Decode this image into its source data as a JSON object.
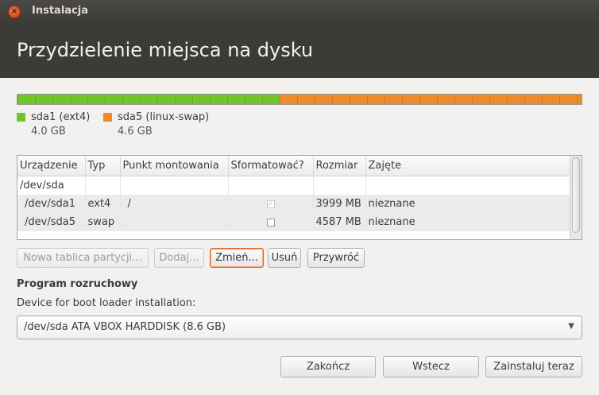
{
  "window": {
    "title": "Instalacja",
    "close_symbol": "×"
  },
  "header": {
    "title": "Przydzielenie miejsca na dysku"
  },
  "disk_map": {
    "segments": [
      {
        "name": "sda1 (ext4)",
        "size": "4.0 GB",
        "color": "#73c42b"
      },
      {
        "name": "sda5 (linux-swap)",
        "size": "4.6 GB",
        "color": "#f08a2a"
      }
    ]
  },
  "partition_table": {
    "columns": [
      "Urządzenie",
      "Typ",
      "Punkt montowania",
      "Sformatować?",
      "Rozmiar",
      "Zajęte"
    ],
    "rows": [
      {
        "device": "/dev/sda",
        "type": "",
        "mount": "",
        "format": null,
        "size": "",
        "used": ""
      },
      {
        "device": "/dev/sda1",
        "type": "ext4",
        "mount": "/",
        "format": true,
        "format_mark": "✓",
        "size": "3999 MB",
        "used": "nieznane"
      },
      {
        "device": "/dev/sda5",
        "type": "swap",
        "mount": "",
        "format": false,
        "size": "4587 MB",
        "used": "nieznane"
      }
    ]
  },
  "table_buttons": {
    "new_table": "Nowa tablica partycji...",
    "add": "Dodaj...",
    "change": "Zmień...",
    "delete": "Usuń",
    "revert": "Przywróć"
  },
  "bootloader": {
    "section_title": "Program rozruchowy",
    "label": "Device for boot loader installation:",
    "selected": "/dev/sda ATA VBOX HARDDISK (8.6 GB)",
    "arrow_symbol": "▼"
  },
  "footer_buttons": {
    "quit": "Zakończ",
    "back": "Wstecz",
    "install": "Zainstaluj teraz"
  }
}
